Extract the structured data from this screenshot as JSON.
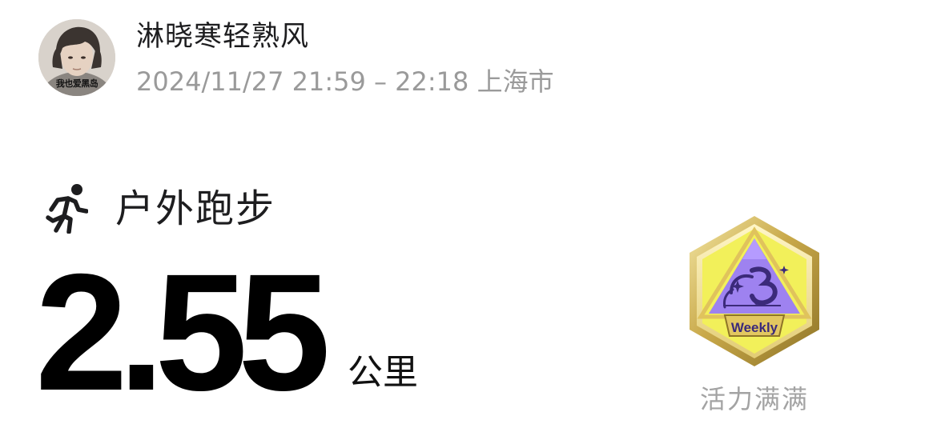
{
  "header": {
    "avatar_caption": "我也爱黑岛",
    "username": "淋晓寒轻熟风",
    "meta": "2024/11/27 21:59 – 22:18 上海市"
  },
  "activity": {
    "icon": "running-person-icon",
    "label": "户外跑步",
    "distance": "2.55",
    "unit": "公里"
  },
  "badge": {
    "icon": "weekly-medal-icon",
    "emblem_text": "Weekly",
    "caption": "活力满满",
    "colors": {
      "gold": "#c9b25a",
      "yellow": "#f2f05a",
      "purple": "#9e82f0"
    }
  }
}
